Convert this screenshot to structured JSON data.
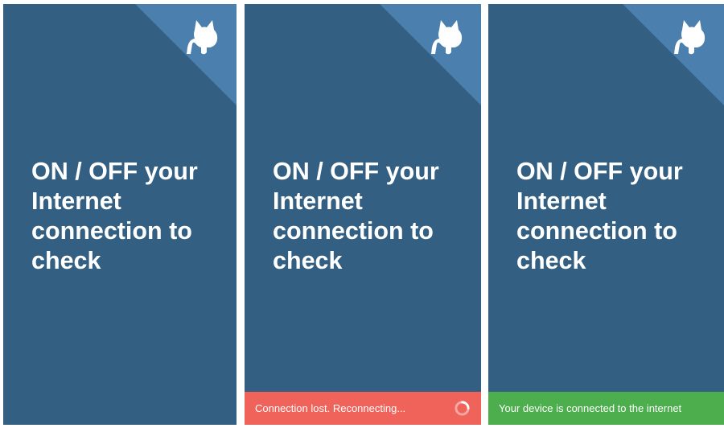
{
  "colors": {
    "background": "#335f82",
    "corner": "#4b7fae",
    "lost": "#f0635a",
    "connected": "#4cae4c",
    "text": "#ffffff"
  },
  "screens": [
    {
      "message": "ON / OFF your Internet connection to check",
      "icon": "github-octocat-icon"
    },
    {
      "message": "ON / OFF your Internet connection to check",
      "icon": "github-octocat-icon",
      "status": {
        "text": "Connection lost. Reconnecting...",
        "icon": "spinner-icon"
      }
    },
    {
      "message": "ON / OFF your Internet connection to check",
      "icon": "github-octocat-icon",
      "status": {
        "text": "Your device is connected to the internet"
      }
    }
  ]
}
